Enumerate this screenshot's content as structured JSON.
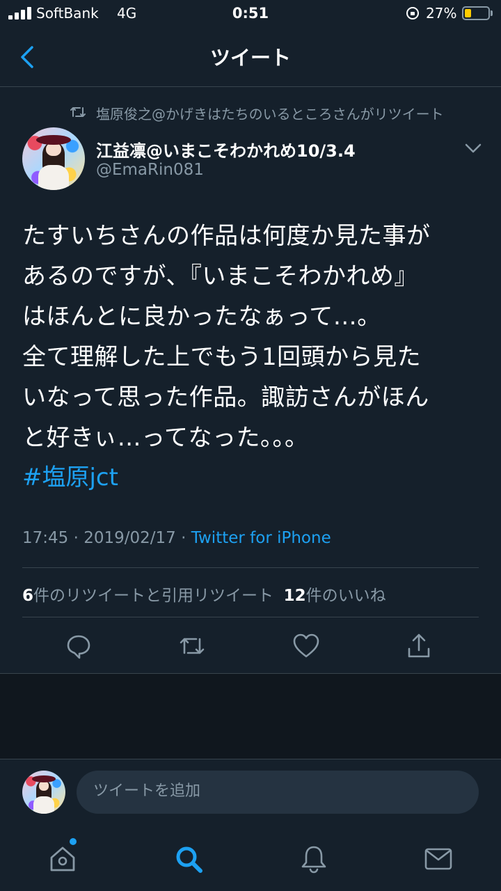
{
  "status_bar": {
    "carrier": "SoftBank",
    "network": "4G",
    "time": "0:51",
    "battery_percent": "27%",
    "battery_level": 0.27,
    "battery_color": "#ffcc00"
  },
  "header": {
    "title": "ツイート",
    "back_icon": "chevron-left-icon"
  },
  "retweet_context": {
    "icon": "retweet-icon",
    "text": "塩原俊之@かげきはたちのいるところさんがリツイート"
  },
  "tweet": {
    "author_name": "江益凛@いまこそわかれめ10/3.4",
    "author_handle": "@EmaRin081",
    "body": "たすいちさんの作品は何度か見た事が\nあるのですが、『いまこそわかれめ』\nはほんとに良かったなぁって…。\n全て理解した上でもう1回頭から見た\nいなって思った作品。諏訪さんがほん\nと好きぃ…ってなった。。。",
    "hashtag": "#塩原jct",
    "time": "17:45",
    "date": "2019/02/17",
    "separator": "·",
    "source": "Twitter for iPhone",
    "retweet_count": "6",
    "retweet_label": "件のリツイートと引用リツイート",
    "like_count": "12",
    "like_label": "件のいいね"
  },
  "actions": [
    "reply-icon",
    "retweet-icon",
    "like-icon",
    "share-icon"
  ],
  "composer": {
    "placeholder": "ツイートを追加"
  },
  "tab_bar": [
    "home-icon",
    "search-icon",
    "notifications-icon",
    "messages-icon"
  ],
  "colors": {
    "background": "#15202b",
    "accent": "#1da1f2",
    "secondary_text": "#8899a6",
    "divider": "#38444d"
  }
}
